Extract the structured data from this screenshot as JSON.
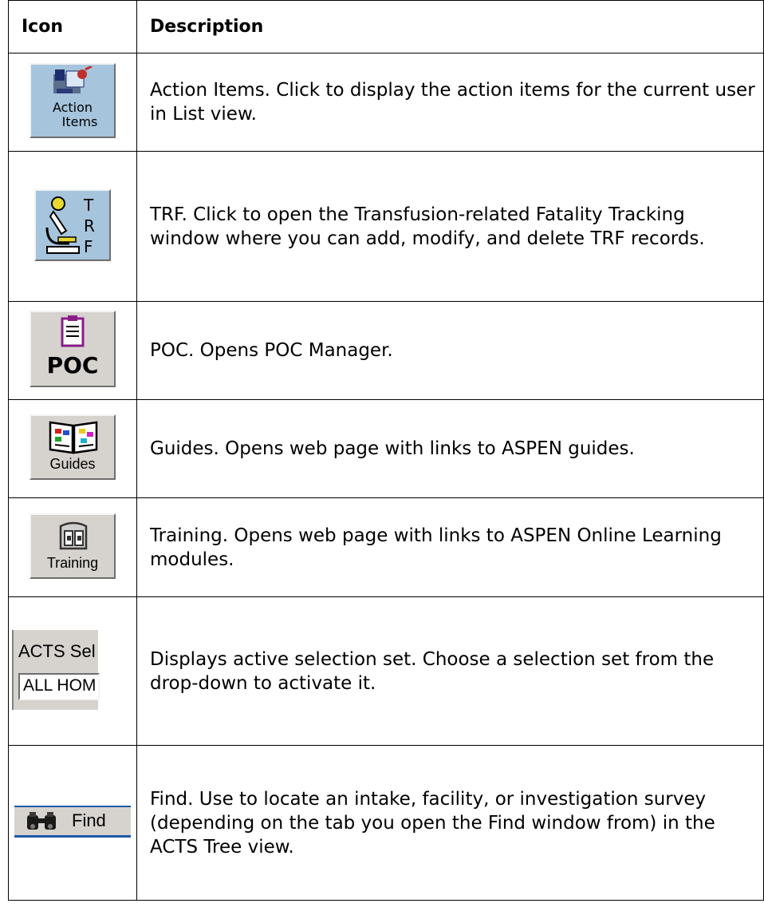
{
  "header": {
    "icon": "Icon",
    "description": "Description"
  },
  "rows": [
    {
      "icon_name": "action-items-icon",
      "icon_label_1": "Action",
      "icon_label_2": "Items",
      "description": "Action Items. Click to display the action items for the current user in List view."
    },
    {
      "icon_name": "trf-microscope-icon",
      "icon_label_1": "T",
      "icon_label_2": "R",
      "icon_label_3": "F",
      "description": "TRF. Click to open the Transfusion-related Fatality Tracking window where you can add, modify, and delete TRF records."
    },
    {
      "icon_name": "poc-clipboard-icon",
      "icon_label_1": "POC",
      "description": "POC. Opens POC Manager."
    },
    {
      "icon_name": "guides-book-icon",
      "icon_label_1": "Guides",
      "description": "Guides. Opens web page with links to ASPEN guides."
    },
    {
      "icon_name": "training-icon",
      "icon_label_1": "Training",
      "description": "Training. Opens web page with links to ASPEN Online Learning modules."
    },
    {
      "icon_name": "selection-set-dropdown",
      "icon_label_1": "ACTS Sel",
      "icon_label_2": "ALL HOM",
      "description": "Displays active selection set. Choose a selection set from the drop-down to activate it."
    },
    {
      "icon_name": "binoculars-icon",
      "icon_label_1": "Find",
      "description": "Find. Use to locate an intake, facility, or investigation survey (depending on the tab you open the Find window from) in the ACTS Tree view."
    }
  ],
  "colors": {
    "blue_button": "#a6c4dc",
    "grey_button": "#d6d3ce",
    "find_border": "#1e5aa8"
  }
}
